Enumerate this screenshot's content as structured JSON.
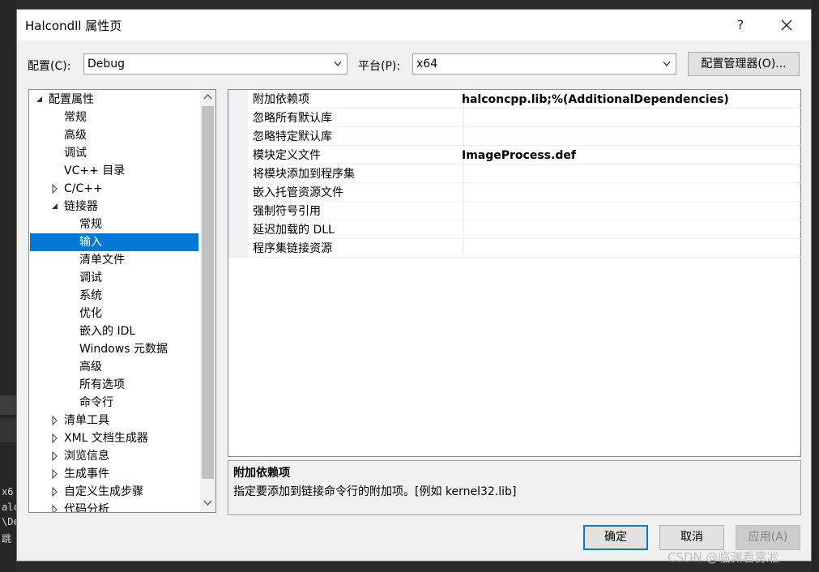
{
  "background": {
    "snippets": [
      "x6",
      "alc",
      "\\De",
      "跳"
    ]
  },
  "dialog": {
    "title": "Halcondll 属性页",
    "help_label": "?",
    "close_label": "✕",
    "config_label": "配置(C):",
    "config_value": "Debug",
    "platform_label": "平台(P):",
    "platform_value": "x64",
    "config_manager_label": "配置管理器(O)..."
  },
  "tree": {
    "items": [
      {
        "label": "配置属性",
        "toggle": "expanded"
      },
      {
        "label": "常规"
      },
      {
        "label": "高级"
      },
      {
        "label": "调试"
      },
      {
        "label": "VC++ 目录"
      },
      {
        "label": "C/C++",
        "toggle": "collapsed"
      },
      {
        "label": "链接器",
        "toggle": "expanded"
      },
      {
        "label": "常规"
      },
      {
        "label": "输入",
        "selected": true
      },
      {
        "label": "清单文件"
      },
      {
        "label": "调试"
      },
      {
        "label": "系统"
      },
      {
        "label": "优化"
      },
      {
        "label": "嵌入的 IDL"
      },
      {
        "label": "Windows 元数据"
      },
      {
        "label": "高级"
      },
      {
        "label": "所有选项"
      },
      {
        "label": "命令行"
      },
      {
        "label": "清单工具",
        "toggle": "collapsed"
      },
      {
        "label": "XML 文档生成器",
        "toggle": "collapsed"
      },
      {
        "label": "浏览信息",
        "toggle": "collapsed"
      },
      {
        "label": "生成事件",
        "toggle": "collapsed"
      },
      {
        "label": "自定义生成步骤",
        "toggle": "collapsed"
      },
      {
        "label": "代码分析",
        "toggle": "collapsed"
      }
    ]
  },
  "grid": {
    "rows": [
      {
        "name": "附加依赖项",
        "value": "halconcpp.lib;%(AdditionalDependencies)"
      },
      {
        "name": "忽略所有默认库",
        "value": ""
      },
      {
        "name": "忽略特定默认库",
        "value": ""
      },
      {
        "name": "模块定义文件",
        "value": "ImageProcess.def"
      },
      {
        "name": "将模块添加到程序集",
        "value": ""
      },
      {
        "name": "嵌入托管资源文件",
        "value": ""
      },
      {
        "name": "强制符号引用",
        "value": ""
      },
      {
        "name": "延迟加载的 DLL",
        "value": ""
      },
      {
        "name": "程序集链接资源",
        "value": ""
      }
    ]
  },
  "description": {
    "title": "附加依赖项",
    "text": "指定要添加到链接命令行的附加项。[例如 kernel32.lib]"
  },
  "buttons": {
    "ok": "确定",
    "cancel": "取消",
    "apply": "应用(A)"
  },
  "watermark": "CSDN @临渊看雾凇"
}
